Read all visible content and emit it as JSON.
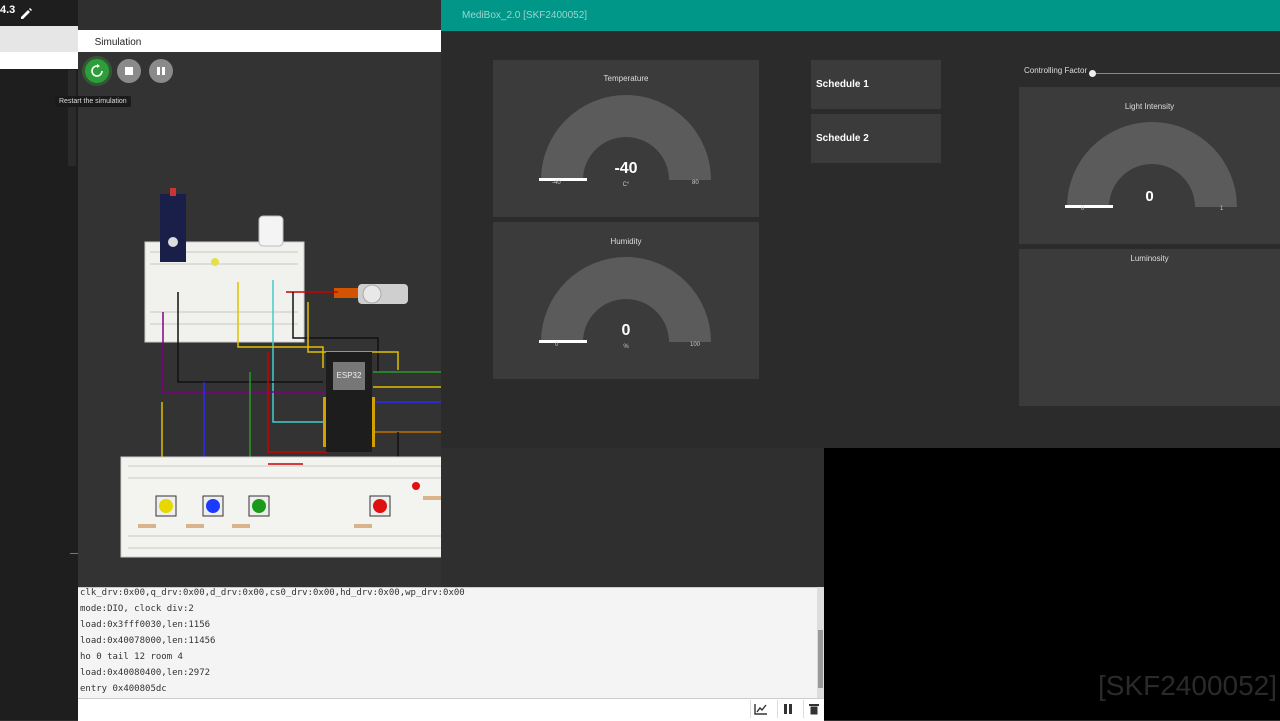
{
  "app": {
    "version": "4.3"
  },
  "simulation": {
    "tab_label": "Simulation",
    "tooltip": "Restart the simulation"
  },
  "dashboard": {
    "title": "MediBox_2.0 [SKF2400052]",
    "header_color": "#009688",
    "temperature": {
      "title": "Temperature",
      "value": "-40",
      "unit": "C°",
      "min": "-40",
      "max": "80",
      "fraction": 0.0
    },
    "humidity": {
      "title": "Humidity",
      "value": "0",
      "unit": "%",
      "min": "0",
      "max": "100",
      "fraction": 0.0
    },
    "schedule1": "Schedule 1",
    "schedule2": "Schedule 2",
    "controlling_factor": {
      "label": "Controlling Factor",
      "fraction": 0.0
    },
    "light_intensity": {
      "title": "Light Intensity",
      "value": "0",
      "min": "0",
      "max": "1",
      "fraction": 0.0
    },
    "luminosity": {
      "title": "Luminosity"
    }
  },
  "console": {
    "lines": [
      "clk_drv:0x00,q_drv:0x00,d_drv:0x00,cs0_drv:0x00,hd_drv:0x00,wp_drv:0x00",
      "mode:DIO, clock div:2",
      "load:0x3fff0030,len:1156",
      "load:0x40078000,len:11456",
      "ho 0 tail 12 room 4",
      "load:0x40080400,len:2972",
      "entry 0x400805dc"
    ]
  },
  "watermark": "[SKF2400052]",
  "colors": {
    "restart_green": "#2e9e3a",
    "teal": "#009688"
  }
}
